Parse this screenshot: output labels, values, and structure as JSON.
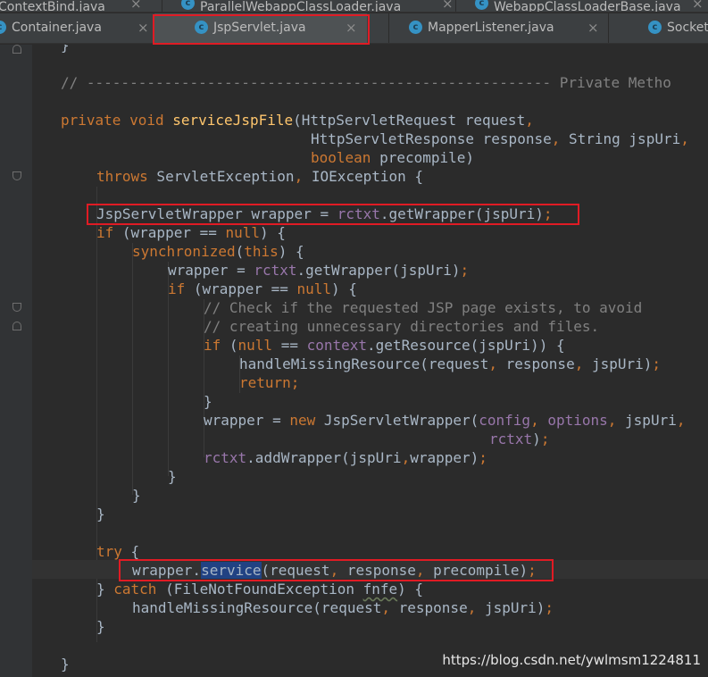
{
  "tabs_row1": [
    {
      "label": "ContextBind.java",
      "has_icon": false
    },
    {
      "label": "ParallelWebappClassLoader.java",
      "has_icon": true
    },
    {
      "label": "WebappClassLoaderBase.java",
      "has_icon": true
    }
  ],
  "tabs_row2": [
    {
      "label": "Container.java"
    },
    {
      "label": "JspServlet.java"
    },
    {
      "label": "MapperListener.java"
    },
    {
      "label": "Socket"
    }
  ],
  "tab_icon_letter": "c",
  "close_glyph": "×",
  "code": {
    "l0": "}",
    "l2_comment": "// ------------------------------------------------------ Private Metho",
    "l4_kw1": "private",
    "l4_kw2": "void",
    "l4_fn": "serviceJspFile",
    "l4_rest": "(HttpServletRequest request",
    "l4_comma": ",",
    "l5_rest": "HttpServletResponse response",
    "l5_comma": ",",
    "l5_rest2": " String jspUri",
    "l5_comma2": ",",
    "l6_kw": "boolean",
    "l6_rest": " precompile)",
    "l7_kw": "throws",
    "l7_rest": " ServletException",
    "l7_comma": ",",
    "l7_rest2": " IOException {",
    "l9_a": "JspServletWrapper wrapper = ",
    "l9_fld": "rctxt",
    "l9_b": ".getWrapper(jspUri)",
    "l9_semi": ";",
    "l10_kw": "if",
    "l10_a": " (wrapper == ",
    "l10_kw2": "null",
    "l10_b": ") {",
    "l11_kw": "synchronized",
    "l11_a": "(",
    "l11_kw2": "this",
    "l11_b": ") {",
    "l12_a": "wrapper = ",
    "l12_fld": "rctxt",
    "l12_b": ".getWrapper(jspUri)",
    "l12_semi": ";",
    "l13_kw": "if",
    "l13_a": " (wrapper == ",
    "l13_kw2": "null",
    "l13_b": ") {",
    "l14_comment": "// Check if the requested JSP page exists, to avoid",
    "l15_comment": "// creating unnecessary directories and files.",
    "l16_kw": "if",
    "l16_a": " (",
    "l16_kw2": "null",
    "l16_b": " == ",
    "l16_fld": "context",
    "l16_c": ".getResource(jspUri)) {",
    "l17_a": "handleMissingResource(request",
    "l17_c1": ",",
    "l17_b": " response",
    "l17_c2": ",",
    "l17_c": " jspUri)",
    "l17_semi": ";",
    "l18_kw": "return;",
    "l19": "}",
    "l20_a": "wrapper = ",
    "l20_kw": "new",
    "l20_b": " JspServletWrapper(",
    "l20_fld1": "config",
    "l20_c1": ",",
    "l20_fld2": " options",
    "l20_c2": ",",
    "l20_c": " jspUri",
    "l20_c3": ",",
    "l21_fld": "rctxt",
    "l21_b": ")",
    "l21_semi": ";",
    "l22_fld": "rctxt",
    "l22_a": ".addWrapper(jspUri",
    "l22_c": ",",
    "l22_b": "wrapper)",
    "l22_semi": ";",
    "l23": "}",
    "l24": "}",
    "l25": "}",
    "l27_kw": "try",
    "l27_a": " {",
    "l28_a": "wrapper.",
    "l28_hl": "service",
    "l28_b": "(request",
    "l28_c1": ",",
    "l28_c": " response",
    "l28_c2": ",",
    "l28_d": " precompile)",
    "l28_semi": ";",
    "l29_a": "} ",
    "l29_kw": "catch",
    "l29_b": " (FileNotFoundException ",
    "l29_var": "fnfe",
    "l29_c": ") {",
    "l30_a": "handleMissingResource(request",
    "l30_c1": ",",
    "l30_b": " response",
    "l30_c2": ",",
    "l30_c": " jspUri)",
    "l30_semi": ";",
    "l31": "}",
    "l33": "}"
  },
  "watermark": "https://blog.csdn.net/ywlmsm1224811",
  "colors": {
    "keyword": "#cc7832",
    "method_decl": "#ffc66d",
    "field": "#9876aa",
    "comment": "#808080",
    "text": "#a9b7c6",
    "annotation_box": "#e01b24",
    "background": "#2b2b2b"
  }
}
